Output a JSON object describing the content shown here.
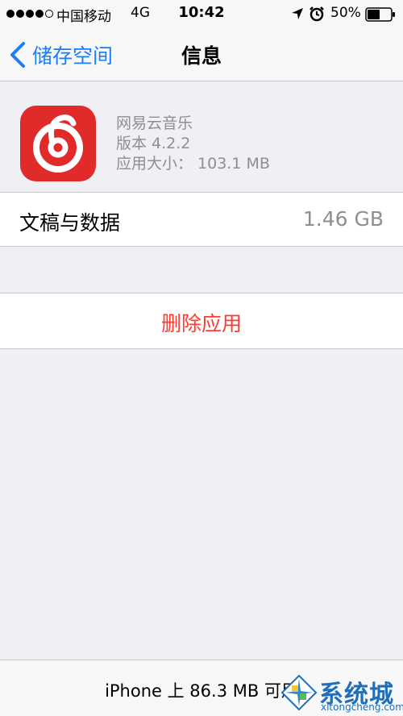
{
  "status_bar": {
    "carrier": "中国移动",
    "network": "4G",
    "time": "10:42",
    "battery": "50%"
  },
  "nav": {
    "back_label": "储存空间",
    "title": "信息"
  },
  "app": {
    "name": "网易云音乐",
    "version": "版本 4.2.2",
    "size": "应用大小：  103.1 MB",
    "icon": "netease-cloud-music-icon",
    "icon_color": "#e12b2b"
  },
  "documents": {
    "label": "文稿与数据",
    "value": "1.46 GB"
  },
  "delete": {
    "label": "删除应用"
  },
  "footer": {
    "storage": "iPhone 上 86.3 MB 可用"
  },
  "watermark": {
    "brand": "系统城",
    "domain": "xitongcheng.com"
  },
  "colors": {
    "accent": "#1a7ef8",
    "destructive": "#ff3b30",
    "secondary_text": "#8e8e93",
    "background": "#efeff4"
  }
}
